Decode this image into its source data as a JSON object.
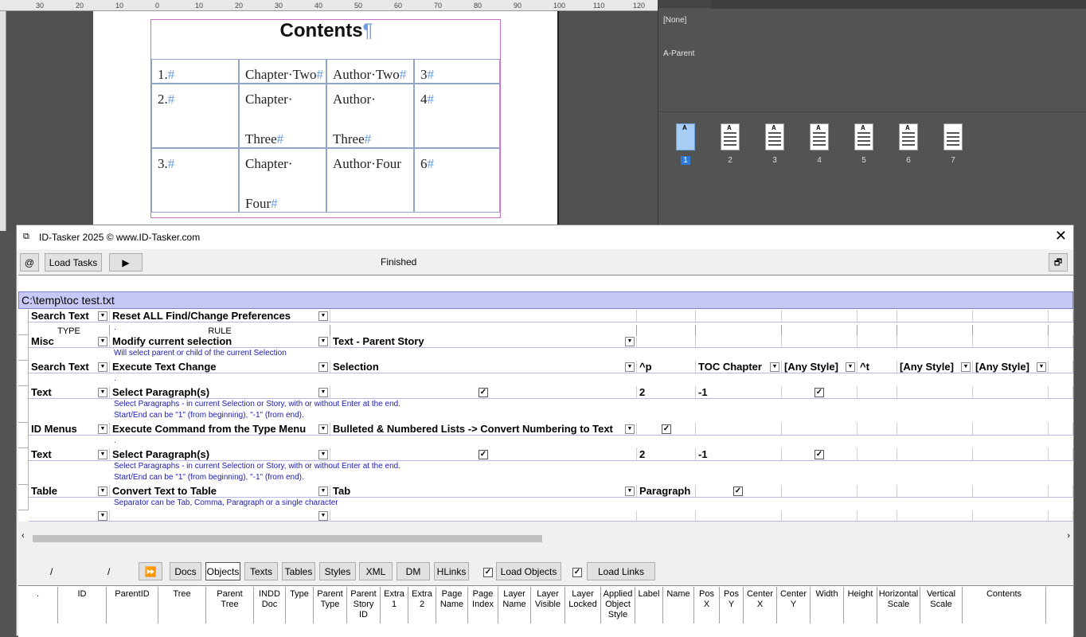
{
  "indesign": {
    "ruler_ticks": [
      "30",
      "20",
      "10",
      "0",
      "10",
      "20",
      "30",
      "40",
      "50",
      "60",
      "70",
      "80",
      "90",
      "100",
      "110",
      "120"
    ],
    "document": {
      "title": "Contents",
      "pilcrow": "¶",
      "hash": "#",
      "rows": [
        [
          "1.",
          "Chapter·Two",
          "Author·Two",
          "3"
        ],
        [
          "2.",
          "Chapter·",
          "Author·",
          "4"
        ],
        [
          "3.",
          "Chapter·",
          "Author·Four",
          "6"
        ]
      ],
      "row2_second_line": [
        "Three",
        "Three"
      ],
      "row3_second_line": [
        "Four"
      ]
    },
    "pages_panel": {
      "none_label": "[None]",
      "parent_label": "A-Parent",
      "page_numbers": [
        "1",
        "2",
        "3",
        "4",
        "5",
        "6",
        "7"
      ],
      "thumb_prefix": "A"
    }
  },
  "tasker": {
    "title": "ID-Tasker 2025  © www.ID-Tasker.com",
    "toolbar": {
      "at_label": "@",
      "load_tasks": "Load Tasks",
      "play_icon": "play-icon",
      "status": "Finished"
    },
    "columns": {
      "type": "TYPE",
      "rule": "RULE"
    },
    "file_path": "C:\\temp\\toc test.txt",
    "rows": [
      {
        "type": "Search Text",
        "rule": "Reset ALL Find/Change Preferences",
        "note": "."
      },
      {
        "type": "Misc",
        "rule": "Modify current selection",
        "p1": "Text - Parent Story",
        "note": "Will select parent or child of the current Selection"
      },
      {
        "type": "Search Text",
        "rule": "Execute Text Change",
        "p1": "Selection",
        "p2": "^p",
        "p3": "TOC Chapter",
        "p4": "[Any Style]",
        "p5": "^t",
        "p6": "[Any Style]",
        "p7": "[Any Style]",
        "note": "."
      },
      {
        "type": "Text",
        "rule": "Select Paragraph(s)",
        "p2": "2",
        "p3": "-1",
        "note": "Select Paragraphs - in current Selection or Story, with or without Enter at the end.",
        "note2": "Start/End can be \"1\" (from beginning), \"-1\" (from end)."
      },
      {
        "type": "ID Menus",
        "rule": "Execute Command from the Type Menu",
        "p1": "Bulleted & Numbered Lists -> Convert Numbering to Text",
        "note": "."
      },
      {
        "type": "Text",
        "rule": "Select Paragraph(s)",
        "p2": "2",
        "p3": "-1",
        "note": "Select Paragraphs - in current Selection or Story, with or without Enter at the end.",
        "note2": "Start/End can be \"1\" (from beginning), \"-1\" (from end)."
      },
      {
        "type": "Table",
        "rule": "Convert Text to Table",
        "p1": "Tab",
        "p2": "Paragraph",
        "note": "Separator can be Tab, Comma, Paragraph or a single character"
      }
    ],
    "bottom_toolbar": {
      "slash1": "/",
      "slash2": "/",
      "ff_icon": "fast-forward-icon",
      "buttons": [
        "Docs",
        "Objects",
        "Texts",
        "Tables",
        "Styles",
        "XML",
        "DM",
        "HLinks"
      ],
      "load_objects": "Load Objects",
      "load_links": "Load Links"
    },
    "object_columns": [
      ".",
      "ID",
      "ParentID",
      "Tree",
      "Parent\nTree",
      "INDD\nDoc",
      "Type",
      "Parent\nType",
      "Parent\nStory\nID",
      "Extra\n1",
      "Extra\n2",
      "Page\nName",
      "Page\nIndex",
      "Layer\nName",
      "Layer\nVisible",
      "Layer\nLocked",
      "Applied\nObject\nStyle",
      "Label",
      "Name",
      "Pos\nX",
      "Pos\nY",
      "Center\nX",
      "Center\nY",
      "Width",
      "Height",
      "Horizontal\nScale",
      "Vertical\nScale",
      "Contents"
    ]
  }
}
